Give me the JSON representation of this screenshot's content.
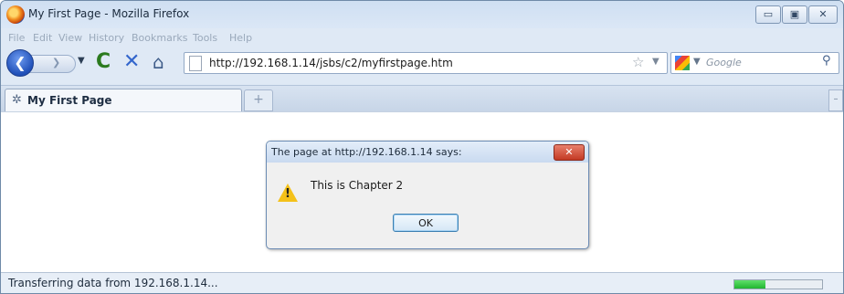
{
  "window": {
    "title": "My First Page - Mozilla Firefox",
    "controls": {
      "minimize": "▭",
      "maximize": "▣",
      "close": "✕"
    }
  },
  "menu": [
    "File",
    "Edit",
    "View",
    "History",
    "Bookmarks",
    "Tools",
    "Help"
  ],
  "nav": {
    "back_glyph": "❮",
    "reload_glyph": "C",
    "stop_glyph": "✕",
    "home_glyph": "⌂",
    "url": "http://192.168.1.14/jsbs/c2/myfirstpage.htm",
    "search_placeholder": "Google",
    "search_glyph": "⚲"
  },
  "tabs": {
    "active_label": "My First Page",
    "new_tab_glyph": "+",
    "scroll_glyph": "–"
  },
  "dialog": {
    "title": "The page at http://192.168.1.14 says:",
    "close_glyph": "✕",
    "message": "This is Chapter 2",
    "ok_label": "OK",
    "icon_glyph": "!"
  },
  "status": {
    "text": "Transferring data from 192.168.1.14...",
    "progress": 0.35
  },
  "colors": {
    "accent": "#1f4fb8",
    "progress": "#21b530",
    "warning": "#f4c11a"
  }
}
